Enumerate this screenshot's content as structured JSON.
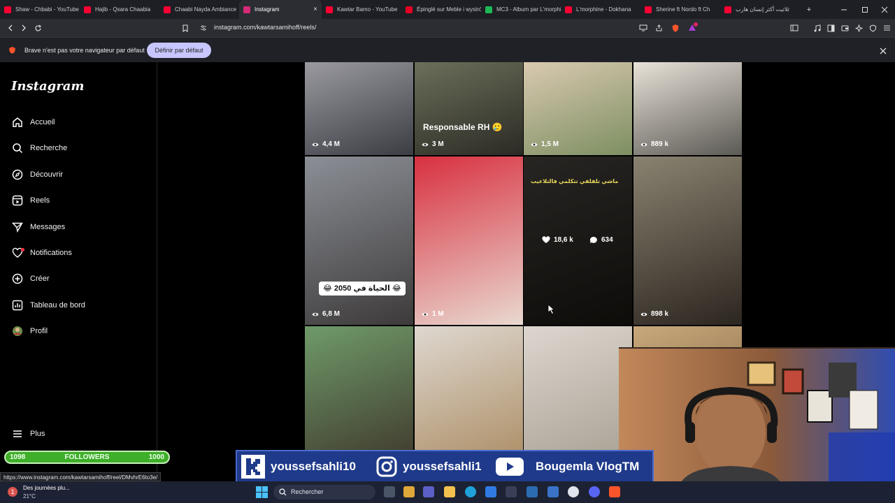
{
  "browser": {
    "tabs": [
      {
        "title": "Shaw - Chbabi - YouTube",
        "fav_color": "#ff0033"
      },
      {
        "title": "Hajib - Qsara Chaabia",
        "fav_color": "#ff0033"
      },
      {
        "title": "Chaabi Nayda Ambiance",
        "fav_color": "#ff0033"
      },
      {
        "title": "Instagram",
        "fav_color": "#d62976",
        "active": true
      },
      {
        "title": "Kawtar Bamo - YouTube",
        "fav_color": "#ff0033"
      },
      {
        "title": "Épinglé sur Meble i wystrój",
        "fav_color": "#e60023"
      },
      {
        "title": "MC3 - Album par L'morphine",
        "fav_color": "#1db954"
      },
      {
        "title": "L'morphine - Dokhana",
        "fav_color": "#ff0033"
      },
      {
        "title": "Sherine ft Nordo ft Ch",
        "fav_color": "#ff0033"
      },
      {
        "title": "ثلاثيت أكثر إنسان هارب",
        "fav_color": "#ff0033"
      }
    ],
    "new_tab": "+",
    "url": "instagram.com/kawtarsamihoff/reels/",
    "infobar": {
      "message": "Brave n'est pas votre navigateur par défaut",
      "button": "Définir par défaut"
    },
    "status_url": "https://www.instagram.com/kawtarsamihoff/reel/DMvhrE6to3e/"
  },
  "instagram": {
    "logo": "Instagram",
    "nav": [
      {
        "label": "Accueil",
        "icon": "home-icon"
      },
      {
        "label": "Recherche",
        "icon": "search-icon"
      },
      {
        "label": "Découvrir",
        "icon": "compass-icon"
      },
      {
        "label": "Reels",
        "icon": "reels-icon"
      },
      {
        "label": "Messages",
        "icon": "send-icon"
      },
      {
        "label": "Notifications",
        "icon": "heart-icon"
      },
      {
        "label": "Créer",
        "icon": "plus-square-icon"
      },
      {
        "label": "Tableau de bord",
        "icon": "chart-icon"
      },
      {
        "label": "Profil",
        "icon": "avatar"
      }
    ],
    "more": "Plus",
    "followers": {
      "current": "1098",
      "label": "FOLLOWERS",
      "goal": "1000"
    },
    "reels": [
      {
        "views": "4,4 M",
        "caption": "",
        "colors": [
          "#9a9aa0",
          "#3b3d44"
        ]
      },
      {
        "views": "3 M",
        "caption": "Responsable RH 🥲",
        "colors": [
          "#6b6f5a",
          "#2b2a24"
        ]
      },
      {
        "views": "1,5 M",
        "caption": "",
        "colors": [
          "#d9c9b0",
          "#7d8f62"
        ]
      },
      {
        "views": "889 k",
        "caption": "",
        "colors": [
          "#e8e2d8",
          "#5c5a55"
        ]
      },
      {
        "views": "6,8 M",
        "caption": "😂 الحياة في 2050 😂",
        "colors": [
          "#8b8f96",
          "#3d3a3a"
        ]
      },
      {
        "views": "1 M",
        "caption": "",
        "colors": [
          "#d83040",
          "#e9d9d0"
        ]
      },
      {
        "views": "",
        "caption": "",
        "likes": "18,6 k",
        "comments": "634",
        "colors": [
          "#3d3a36",
          "#16130f"
        ]
      },
      {
        "views": "898 k",
        "caption": "",
        "colors": [
          "#8a8270",
          "#2c2620"
        ]
      },
      {
        "views": "",
        "caption": "",
        "colors": [
          "#6f9a6a",
          "#3b3026"
        ]
      },
      {
        "views": "",
        "caption": "",
        "colors": [
          "#ded8d0",
          "#a7865a"
        ]
      },
      {
        "views": "",
        "caption": "",
        "colors": [
          "#dcd6cf",
          "#a49b8d"
        ]
      },
      {
        "views": "",
        "caption": "",
        "colors": [
          "#c8a97c",
          "#6a4c2d"
        ]
      }
    ],
    "reel7_overlay_text": "ماشي تلفلفي تتكلمي فالتلاعيب"
  },
  "overlay": {
    "socials": [
      {
        "handle": "youssefsahli10",
        "icon": "kick-icon"
      },
      {
        "handle": "youssefsahli1",
        "icon": "instagram-icon"
      },
      {
        "handle": "Bougemla VlogTM",
        "icon": "youtube-icon"
      }
    ]
  },
  "taskbar": {
    "weather_title": "Des journées plu...",
    "weather_temp": "21°C",
    "search": "Rechercher"
  },
  "colors": {
    "accent": "#c7c6ff",
    "ig_notification": "#ff3040",
    "followers_green": "#3fae2a",
    "socials_blue": "#1f3a8a"
  }
}
